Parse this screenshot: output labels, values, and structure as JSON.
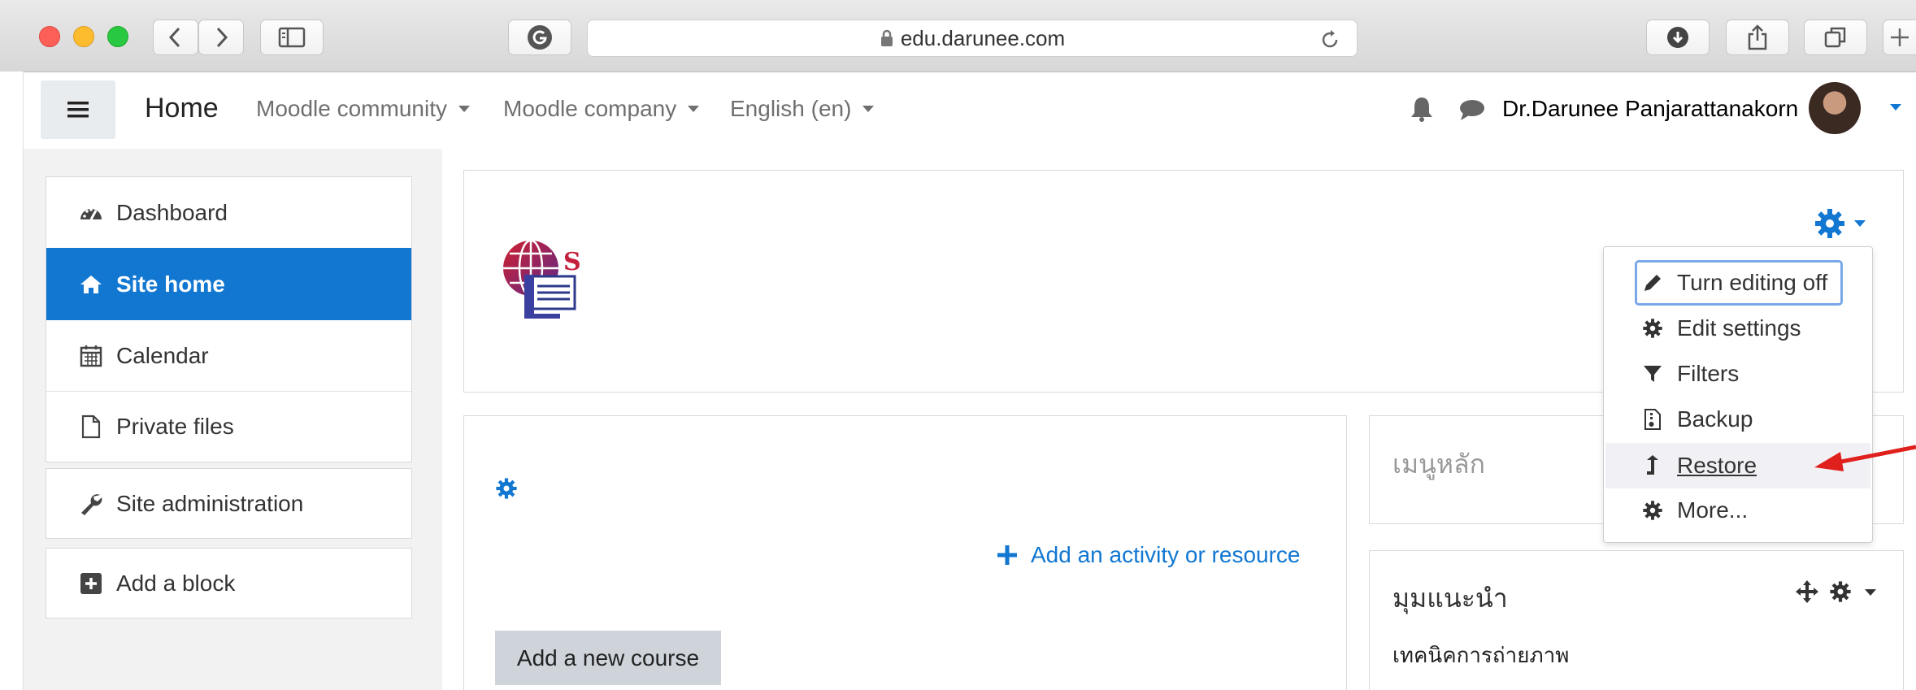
{
  "browser": {
    "url": "edu.darunee.com",
    "icons": [
      "back-icon",
      "forward-icon",
      "sidebar-icon",
      "grammarly-icon",
      "lock-icon",
      "reload-icon",
      "download-icon",
      "share-icon",
      "tabs-icon",
      "new-tab-icon"
    ]
  },
  "navbar": {
    "home": "Home",
    "menus": [
      "Moodle community",
      "Moodle company",
      "English (en)"
    ],
    "user_name": "Dr.Darunee Panjarattanakorn"
  },
  "sidebar": {
    "items": [
      {
        "label": "Dashboard",
        "icon": "dashboard-icon"
      },
      {
        "label": "Site home",
        "icon": "home-icon",
        "active": true
      },
      {
        "label": "Calendar",
        "icon": "calendar-icon"
      },
      {
        "label": "Private files",
        "icon": "file-icon"
      }
    ],
    "admin": {
      "label": "Site administration",
      "icon": "wrench-icon"
    },
    "add_block": {
      "label": "Add a block",
      "icon": "plus-square-icon"
    }
  },
  "settings_menu": {
    "items": [
      {
        "label": "Turn editing off",
        "icon": "pencil-icon"
      },
      {
        "label": "Edit settings",
        "icon": "gear-icon"
      },
      {
        "label": "Filters",
        "icon": "filter-icon"
      },
      {
        "label": "Backup",
        "icon": "file-archive-icon"
      },
      {
        "label": "Restore",
        "icon": "restore-icon"
      },
      {
        "label": "More...",
        "icon": "gear-icon"
      }
    ]
  },
  "main": {
    "add_activity": "Add an activity or resource",
    "add_course": "Add a new course"
  },
  "blocks": {
    "main_menu_title": "เมนูหลัก",
    "tips_title": "มุมแนะนำ",
    "tips_item": "เทคนิคการถ่ายภาพ"
  },
  "colors": {
    "accent": "#1177d1",
    "active_bg": "#1177d1",
    "arrow": "#e0201c"
  }
}
